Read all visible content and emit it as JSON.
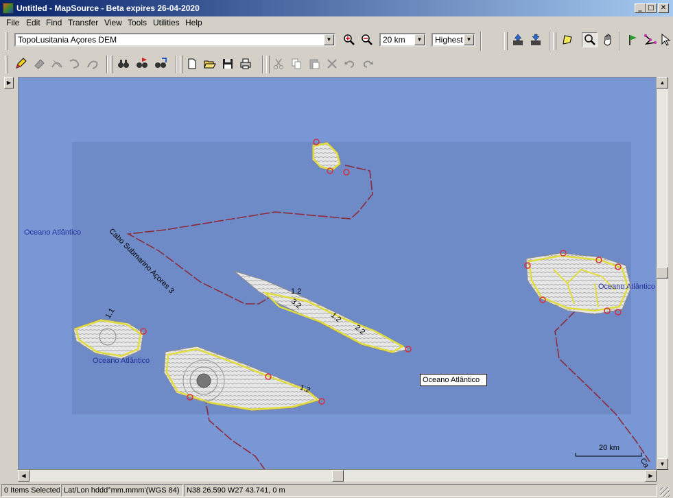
{
  "window": {
    "title": "Untitled - MapSource - Beta expires 26-04-2020",
    "controls": {
      "minimize": "_",
      "maximize": "□",
      "close": "✕"
    }
  },
  "menu": [
    "File",
    "Edit",
    "Find",
    "Transfer",
    "View",
    "Tools",
    "Utilities",
    "Help"
  ],
  "toolbar": {
    "map_product": "TopoLusitania Açores DEM",
    "zoom_level": "20 km",
    "detail_level": "Highest"
  },
  "map": {
    "ocean_labels": {
      "left": "Oceano Atlântico",
      "island_west": "Oceano Atlântico",
      "island_east": "Oceano Atlântico"
    },
    "cable_label": "Cabo Submarino Açores 3",
    "cable_label_edge": "Ca",
    "road_labels": [
      "1.2",
      "3.2",
      "1.2",
      "2.2",
      "1.1",
      "1.2"
    ],
    "tooltip": "Oceano Atlântico",
    "scale": "20 km",
    "colors": {
      "ocean": "#7a97d5",
      "coverage": "#6f8bc7",
      "road": "#e0dc3c",
      "cable": "#8b2a3a"
    }
  },
  "status": {
    "selection": "0 Items Selected",
    "format": "Lat/Lon hddd°mm.mmm'(WGS 84)",
    "position": "N38 26.590 W27 43.741, 0 m"
  }
}
